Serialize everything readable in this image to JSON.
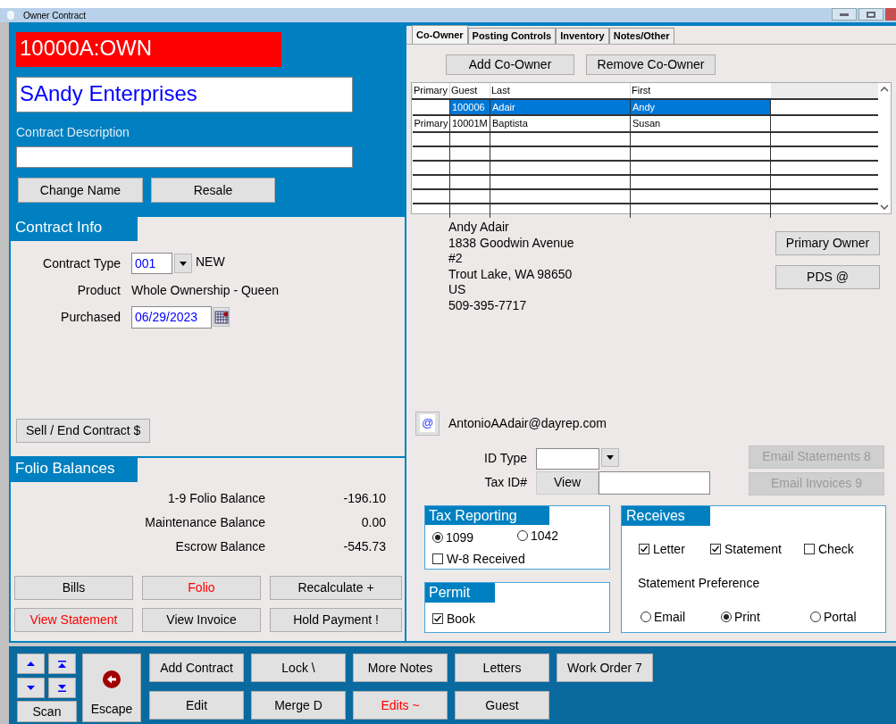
{
  "window": {
    "title": "Owner Contract"
  },
  "header": {
    "contract_id": "10000A:OWN",
    "owner_name": "SAndy Enterprises",
    "description_label": "Contract Description",
    "buttons": [
      "Change Name",
      "Resale"
    ]
  },
  "contract_info": {
    "title": "Contract Info",
    "fields": [
      {
        "kind": "dropdown",
        "label": "Contract Type",
        "value": "001",
        "note": "NEW"
      },
      {
        "kind": "text",
        "label": "Product",
        "value": "Whole Ownership - Queen"
      },
      {
        "kind": "date",
        "label": "Purchased",
        "value": "06/29/2023"
      }
    ],
    "button": "Sell / End Contract $"
  },
  "folio": {
    "title": "Folio Balances",
    "balances": [
      {
        "label": "1-9 Folio Balance",
        "value": "-196.10"
      },
      {
        "label": "Maintenance Balance",
        "value": "0.00"
      },
      {
        "label": "Escrow Balance",
        "value": "-545.73"
      }
    ],
    "buttons": [
      {
        "label": "Bills",
        "highlighted": false
      },
      {
        "label": "Folio",
        "highlighted": true
      },
      {
        "label": "Recalculate +",
        "highlighted": false
      },
      {
        "label": "View Statement",
        "highlighted": true
      },
      {
        "label": "View Invoice",
        "highlighted": false
      },
      {
        "label": "Hold Payment !",
        "highlighted": false
      }
    ]
  },
  "tabs": [
    {
      "label": "Co-Owner",
      "selected": true
    },
    {
      "label": "Posting Controls",
      "selected": false
    },
    {
      "label": "Inventory",
      "selected": false
    },
    {
      "label": "Notes/Other",
      "selected": false
    }
  ],
  "co_owner": {
    "buttons": [
      "Add Co-Owner",
      "Remove Co-Owner"
    ],
    "table": {
      "columns": [
        "Primary",
        "Guest",
        "Last",
        "First"
      ],
      "rows": [
        {
          "guest": "100006",
          "last": "Adair",
          "first": "Andy",
          "selected": true
        },
        {
          "primary": "Primary",
          "guest": "10001M",
          "last": "Baptista",
          "first": "Susan",
          "selected": false
        }
      ]
    },
    "address": [
      "Andy Adair",
      "1838 Goodwin Avenue",
      "#2",
      "Trout Lake, WA 98650",
      "US",
      "509-395-7717"
    ],
    "side_buttons": [
      "Primary Owner",
      "PDS @"
    ],
    "email_icon": "@",
    "email": "AntonioAAdair@dayrep.com",
    "id_type_label": "ID Type",
    "tax_id_label": "Tax ID#",
    "view_button": "View",
    "email_buttons": [
      {
        "label": "Email Statements 8",
        "disabled": true
      },
      {
        "label": "Email Invoices 9",
        "disabled": true
      }
    ],
    "tax_reporting": {
      "title": "Tax Reporting",
      "options": [
        {
          "label": "1099",
          "selected": true
        },
        {
          "label": "1042",
          "selected": false
        }
      ],
      "checkbox": {
        "label": "W-8 Received",
        "checked": false
      }
    },
    "permit": {
      "title": "Permit",
      "items": [
        {
          "label": "Book",
          "checked": true
        }
      ]
    },
    "receives": {
      "title": "Receives",
      "items": [
        {
          "label": "Letter",
          "checked": true
        },
        {
          "label": "Statement",
          "checked": true
        },
        {
          "label": "Check",
          "checked": false
        }
      ],
      "preference_label": "Statement Preference",
      "preferences": [
        {
          "label": "Email",
          "selected": false
        },
        {
          "label": "Print",
          "selected": true
        },
        {
          "label": "Portal",
          "selected": false
        }
      ]
    }
  },
  "toolbar": {
    "scan": "Scan",
    "escape": "Escape",
    "buttons": [
      {
        "label": "Add Contract",
        "highlighted": false
      },
      {
        "label": "Lock \\",
        "highlighted": false
      },
      {
        "label": "More Notes",
        "highlighted": false
      },
      {
        "label": "Letters",
        "highlighted": false
      },
      {
        "label": "Work Order 7",
        "highlighted": false
      },
      {
        "label": "Edit",
        "highlighted": false
      },
      {
        "label": "Merge D",
        "highlighted": false
      },
      {
        "label": "Edits ~",
        "highlighted": true
      },
      {
        "label": "Guest",
        "highlighted": false
      }
    ]
  }
}
